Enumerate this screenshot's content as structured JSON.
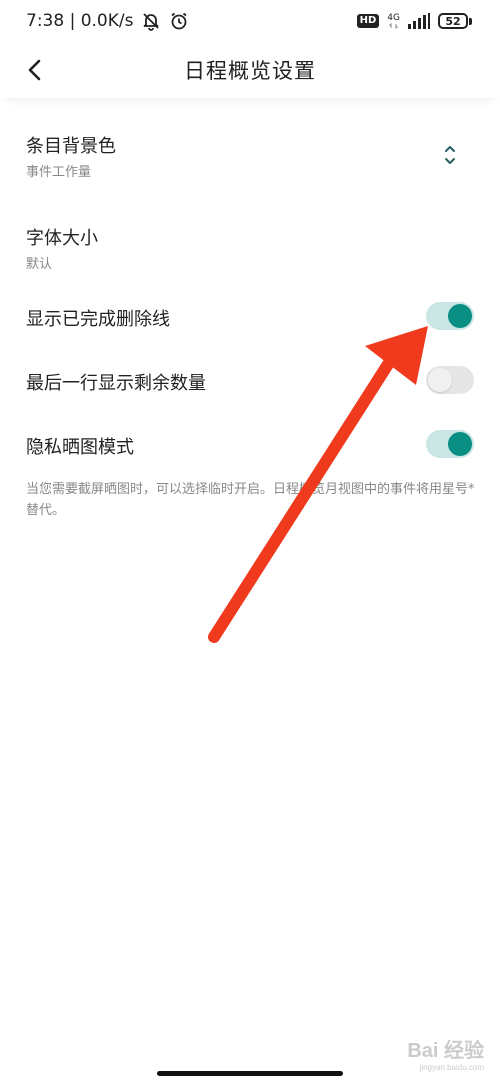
{
  "status_bar": {
    "time_speed": "7:38 | 0.0K/s",
    "hd": "HD",
    "network": "4G",
    "battery": "52"
  },
  "header": {
    "title": "日程概览设置"
  },
  "settings": {
    "item_bg_color": {
      "title": "条目背景色",
      "value": "事件工作量"
    },
    "font_size": {
      "title": "字体大小",
      "value": "默认"
    },
    "show_strikethrough": {
      "title": "显示已完成删除线",
      "enabled": true
    },
    "show_remaining": {
      "title": "最后一行显示剩余数量",
      "enabled": false
    },
    "privacy_mode": {
      "title": "隐私晒图模式",
      "enabled": true,
      "hint": "当您需要截屏晒图时，可以选择临时开启。日程概览月视图中的事件将用星号*替代。"
    }
  },
  "colors": {
    "accent": "#0a8f84",
    "toggle_track_on": "#c9e5e4",
    "annotation_arrow": "#f03a1e"
  },
  "watermark": "Bai 经验",
  "watermark_url": "jingyan.baidu.com"
}
